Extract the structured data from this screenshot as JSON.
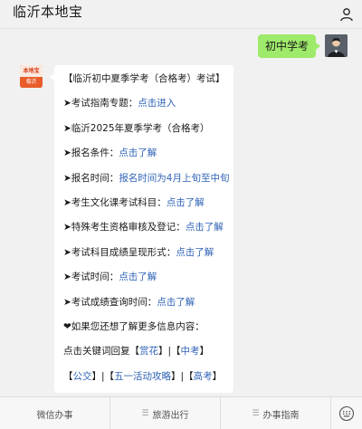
{
  "header": {
    "title": "临沂本地宝"
  },
  "chat": {
    "user_message": "初中学考",
    "bot_avatar": {
      "top_text": "本地宝",
      "bottom_text": "临沂"
    },
    "reply": {
      "title": "【临沂初中夏季学考（合格考）考试】",
      "items": [
        {
          "prefix": "➤考试指南专题：",
          "link": "点击进入"
        },
        {
          "prefix": "➤临沂2025年夏季学考（合格考）",
          "link": ""
        },
        {
          "prefix": "➤报名条件：",
          "link": "点击了解"
        },
        {
          "prefix": "➤报名时间：",
          "link": "报名时间为4月上旬至中旬"
        },
        {
          "prefix": "➤考生文化课考试科目：",
          "link": "点击了解"
        },
        {
          "prefix": "➤特殊考生资格审核及登记：",
          "link": "点击了解"
        },
        {
          "prefix": "➤考试科目成绩呈现形式：",
          "link": "点击了解"
        },
        {
          "prefix": "➤考试时间：",
          "link": "点击了解"
        },
        {
          "prefix": "➤考试成绩查询时间：",
          "link": "点击了解"
        }
      ],
      "more_info": "❤如果您还想了解更多信息内容：",
      "keyword_intro": "点击关键词回复",
      "keywords": {
        "lb1": "【",
        "k1": "赏花",
        "rb1": "】",
        "sep1": "|",
        "lb2": "【",
        "k2": "中考",
        "rb2": "】",
        "lb3": "【",
        "k3": "公交",
        "rb3": "】",
        "sep2": "|",
        "lb4": "【",
        "k4": "五一活动攻略",
        "rb4": "】",
        "sep3": "|",
        "lb5": "【",
        "k5": "高考",
        "rb5": "】"
      }
    }
  },
  "footer": {
    "tabs": [
      {
        "label": "微信办事",
        "icon": ""
      },
      {
        "label": "旅游出行",
        "icon": "menu-icon"
      },
      {
        "label": "办事指南",
        "icon": "menu-icon"
      }
    ],
    "keyboard_icon": "keyboard-icon"
  },
  "colors": {
    "link": "#2f63b6",
    "bubble_green": "#9eea6a",
    "background": "#f1f1f1"
  }
}
